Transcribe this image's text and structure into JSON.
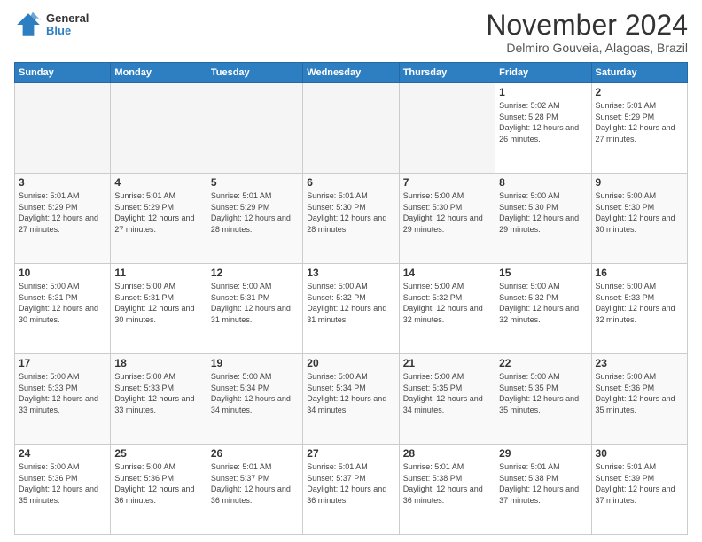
{
  "header": {
    "logo_line1": "General",
    "logo_line2": "Blue",
    "month": "November 2024",
    "location": "Delmiro Gouveia, Alagoas, Brazil"
  },
  "weekdays": [
    "Sunday",
    "Monday",
    "Tuesday",
    "Wednesday",
    "Thursday",
    "Friday",
    "Saturday"
  ],
  "weeks": [
    [
      {
        "day": "",
        "info": ""
      },
      {
        "day": "",
        "info": ""
      },
      {
        "day": "",
        "info": ""
      },
      {
        "day": "",
        "info": ""
      },
      {
        "day": "",
        "info": ""
      },
      {
        "day": "1",
        "info": "Sunrise: 5:02 AM\nSunset: 5:28 PM\nDaylight: 12 hours and 26 minutes."
      },
      {
        "day": "2",
        "info": "Sunrise: 5:01 AM\nSunset: 5:29 PM\nDaylight: 12 hours and 27 minutes."
      }
    ],
    [
      {
        "day": "3",
        "info": "Sunrise: 5:01 AM\nSunset: 5:29 PM\nDaylight: 12 hours and 27 minutes."
      },
      {
        "day": "4",
        "info": "Sunrise: 5:01 AM\nSunset: 5:29 PM\nDaylight: 12 hours and 27 minutes."
      },
      {
        "day": "5",
        "info": "Sunrise: 5:01 AM\nSunset: 5:29 PM\nDaylight: 12 hours and 28 minutes."
      },
      {
        "day": "6",
        "info": "Sunrise: 5:01 AM\nSunset: 5:30 PM\nDaylight: 12 hours and 28 minutes."
      },
      {
        "day": "7",
        "info": "Sunrise: 5:00 AM\nSunset: 5:30 PM\nDaylight: 12 hours and 29 minutes."
      },
      {
        "day": "8",
        "info": "Sunrise: 5:00 AM\nSunset: 5:30 PM\nDaylight: 12 hours and 29 minutes."
      },
      {
        "day": "9",
        "info": "Sunrise: 5:00 AM\nSunset: 5:30 PM\nDaylight: 12 hours and 30 minutes."
      }
    ],
    [
      {
        "day": "10",
        "info": "Sunrise: 5:00 AM\nSunset: 5:31 PM\nDaylight: 12 hours and 30 minutes."
      },
      {
        "day": "11",
        "info": "Sunrise: 5:00 AM\nSunset: 5:31 PM\nDaylight: 12 hours and 30 minutes."
      },
      {
        "day": "12",
        "info": "Sunrise: 5:00 AM\nSunset: 5:31 PM\nDaylight: 12 hours and 31 minutes."
      },
      {
        "day": "13",
        "info": "Sunrise: 5:00 AM\nSunset: 5:32 PM\nDaylight: 12 hours and 31 minutes."
      },
      {
        "day": "14",
        "info": "Sunrise: 5:00 AM\nSunset: 5:32 PM\nDaylight: 12 hours and 32 minutes."
      },
      {
        "day": "15",
        "info": "Sunrise: 5:00 AM\nSunset: 5:32 PM\nDaylight: 12 hours and 32 minutes."
      },
      {
        "day": "16",
        "info": "Sunrise: 5:00 AM\nSunset: 5:33 PM\nDaylight: 12 hours and 32 minutes."
      }
    ],
    [
      {
        "day": "17",
        "info": "Sunrise: 5:00 AM\nSunset: 5:33 PM\nDaylight: 12 hours and 33 minutes."
      },
      {
        "day": "18",
        "info": "Sunrise: 5:00 AM\nSunset: 5:33 PM\nDaylight: 12 hours and 33 minutes."
      },
      {
        "day": "19",
        "info": "Sunrise: 5:00 AM\nSunset: 5:34 PM\nDaylight: 12 hours and 34 minutes."
      },
      {
        "day": "20",
        "info": "Sunrise: 5:00 AM\nSunset: 5:34 PM\nDaylight: 12 hours and 34 minutes."
      },
      {
        "day": "21",
        "info": "Sunrise: 5:00 AM\nSunset: 5:35 PM\nDaylight: 12 hours and 34 minutes."
      },
      {
        "day": "22",
        "info": "Sunrise: 5:00 AM\nSunset: 5:35 PM\nDaylight: 12 hours and 35 minutes."
      },
      {
        "day": "23",
        "info": "Sunrise: 5:00 AM\nSunset: 5:36 PM\nDaylight: 12 hours and 35 minutes."
      }
    ],
    [
      {
        "day": "24",
        "info": "Sunrise: 5:00 AM\nSunset: 5:36 PM\nDaylight: 12 hours and 35 minutes."
      },
      {
        "day": "25",
        "info": "Sunrise: 5:00 AM\nSunset: 5:36 PM\nDaylight: 12 hours and 36 minutes."
      },
      {
        "day": "26",
        "info": "Sunrise: 5:01 AM\nSunset: 5:37 PM\nDaylight: 12 hours and 36 minutes."
      },
      {
        "day": "27",
        "info": "Sunrise: 5:01 AM\nSunset: 5:37 PM\nDaylight: 12 hours and 36 minutes."
      },
      {
        "day": "28",
        "info": "Sunrise: 5:01 AM\nSunset: 5:38 PM\nDaylight: 12 hours and 36 minutes."
      },
      {
        "day": "29",
        "info": "Sunrise: 5:01 AM\nSunset: 5:38 PM\nDaylight: 12 hours and 37 minutes."
      },
      {
        "day": "30",
        "info": "Sunrise: 5:01 AM\nSunset: 5:39 PM\nDaylight: 12 hours and 37 minutes."
      }
    ]
  ]
}
